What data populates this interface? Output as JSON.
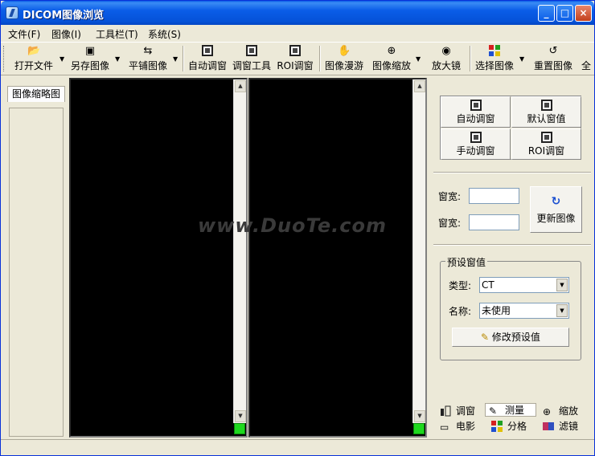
{
  "window": {
    "title": "DICOM图像浏览",
    "icon": "app-icon",
    "controls": {
      "minimize": "_",
      "maximize": "□",
      "close": "×"
    }
  },
  "menu": [
    {
      "label": "文件(F)"
    },
    {
      "label": "图像(I)"
    },
    {
      "label": "工具栏(T)"
    },
    {
      "label": "系统(S)"
    }
  ],
  "toolbar": [
    {
      "label": "打开文件",
      "icon": "folder-open-icon",
      "dropdown": true
    },
    {
      "label": "另存图像",
      "icon": "save-image-icon",
      "dropdown": true
    },
    {
      "label": "平铺图像",
      "icon": "tile-icon",
      "dropdown": true
    },
    {
      "label": "自动调窗",
      "icon": "auto-window-icon",
      "dropdown": false
    },
    {
      "label": "调窗工具",
      "icon": "window-tool-icon",
      "dropdown": false
    },
    {
      "label": "ROI调窗",
      "icon": "roi-window-icon",
      "dropdown": false
    },
    {
      "label": "图像漫游",
      "icon": "hand-pan-icon",
      "dropdown": false
    },
    {
      "label": "图像缩放",
      "icon": "zoom-icon",
      "dropdown": true
    },
    {
      "label": "放大镜",
      "icon": "magnifier-icon",
      "dropdown": false
    },
    {
      "label": "选择图像",
      "icon": "select-image-icon",
      "dropdown": true
    },
    {
      "label": "重置图像",
      "icon": "reset-image-icon",
      "dropdown": false
    },
    {
      "label": "全",
      "icon": "",
      "dropdown": false
    }
  ],
  "left_panel": {
    "tab_label": "图像缩略图"
  },
  "viewers": {
    "watermark": "www.DuoTe.com"
  },
  "right_panel": {
    "window_buttons": [
      {
        "label": "自动调窗"
      },
      {
        "label": "默认窗值"
      },
      {
        "label": "手动调窗"
      },
      {
        "label": "ROI调窗"
      }
    ],
    "width_label": "窗宽:",
    "level_label": "窗宽:",
    "update_button": "更新图像",
    "preset": {
      "group_title": "预设窗值",
      "type_label": "类型:",
      "type_value": "CT",
      "name_label": "名称:",
      "name_value": "未使用",
      "modify_button": "修改预设值"
    },
    "tabs": [
      {
        "label": "调窗",
        "icon": "window-adjust-icon"
      },
      {
        "label": "测量",
        "icon": "measure-icon"
      },
      {
        "label": "缩放",
        "icon": "zoom-tab-icon"
      },
      {
        "label": "电影",
        "icon": "movie-icon"
      },
      {
        "label": "分格",
        "icon": "grid-icon"
      },
      {
        "label": "滤镜",
        "icon": "filter-icon"
      }
    ]
  }
}
